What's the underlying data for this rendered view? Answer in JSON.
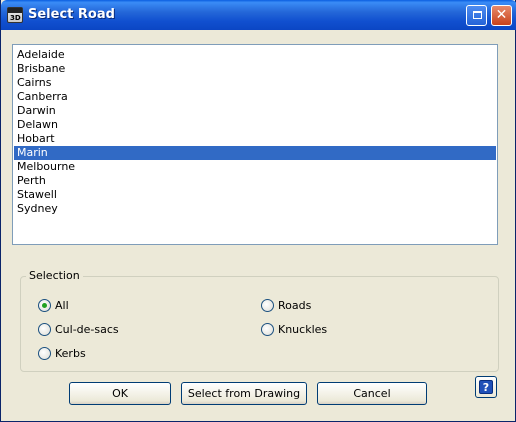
{
  "window": {
    "title": "Select Road",
    "app_icon_label": "3D",
    "restore_icon": "restore-icon",
    "close_glyph": "✕"
  },
  "road_list": {
    "items": [
      "Adelaide",
      "Brisbane",
      "Cairns",
      "Canberra",
      "Darwin",
      "Delawn",
      "Hobart",
      "Marin",
      "Melbourne",
      "Perth",
      "Stawell",
      "Sydney"
    ],
    "selected": "Marin"
  },
  "selection": {
    "label": "Selection",
    "options": {
      "all": "All",
      "roads": "Roads",
      "cul_de_sacs": "Cul-de-sacs",
      "knuckles": "Knuckles",
      "kerbs": "Kerbs"
    },
    "checked": "all"
  },
  "buttons": {
    "ok": "OK",
    "select_from_drawing": "Select from Drawing",
    "cancel": "Cancel",
    "help_glyph": "?"
  },
  "colors": {
    "title_bar": "#2467d8",
    "selected_item": "#316ac5",
    "radio_dot": "#21a121"
  }
}
